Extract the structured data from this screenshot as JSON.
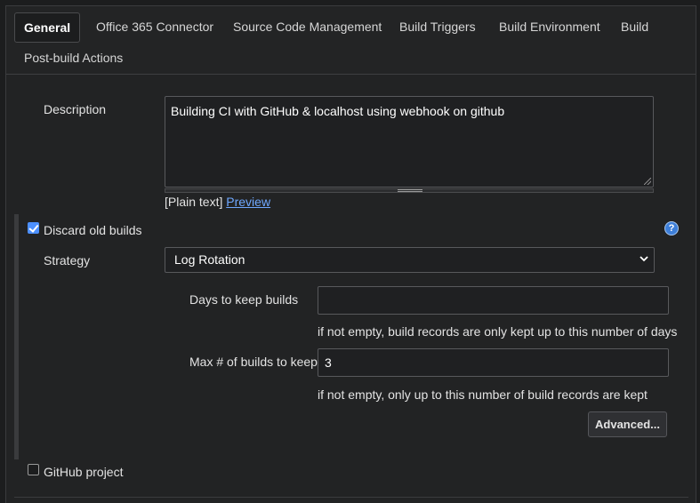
{
  "tabs": [
    {
      "label": "General",
      "active": true
    },
    {
      "label": "Office 365 Connector",
      "active": false
    },
    {
      "label": "Source Code Management",
      "active": false
    },
    {
      "label": "Build Triggers",
      "active": false
    },
    {
      "label": "Build Environment",
      "active": false
    },
    {
      "label": "Build",
      "active": false
    },
    {
      "label": "Post-build Actions",
      "active": false
    }
  ],
  "description": {
    "label": "Description",
    "value": "Building CI with GitHub & localhost using webhook on github",
    "format_prefix": "[Plain text]",
    "preview_link": "Preview"
  },
  "discard_old_builds": {
    "label": "Discard old builds",
    "checked": true,
    "help_icon": "question-icon",
    "help_glyph": "?",
    "strategy": {
      "label": "Strategy",
      "selected": "Log Rotation"
    },
    "days_to_keep": {
      "label": "Days to keep builds",
      "value": "",
      "hint": "if not empty, build records are only kept up to this number of days"
    },
    "max_builds": {
      "label": "Max # of builds to keep",
      "value": "3",
      "hint": "if not empty, only up to this number of build records are kept"
    },
    "advanced_button": "Advanced..."
  },
  "github_project": {
    "label": "GitHub project",
    "checked": false
  },
  "colors": {
    "background": "#1c1d1e",
    "panel": "#222324",
    "link": "#6fa8ff",
    "checkbox_accent": "#4d90fe",
    "help_icon": "#3e7fd9"
  }
}
